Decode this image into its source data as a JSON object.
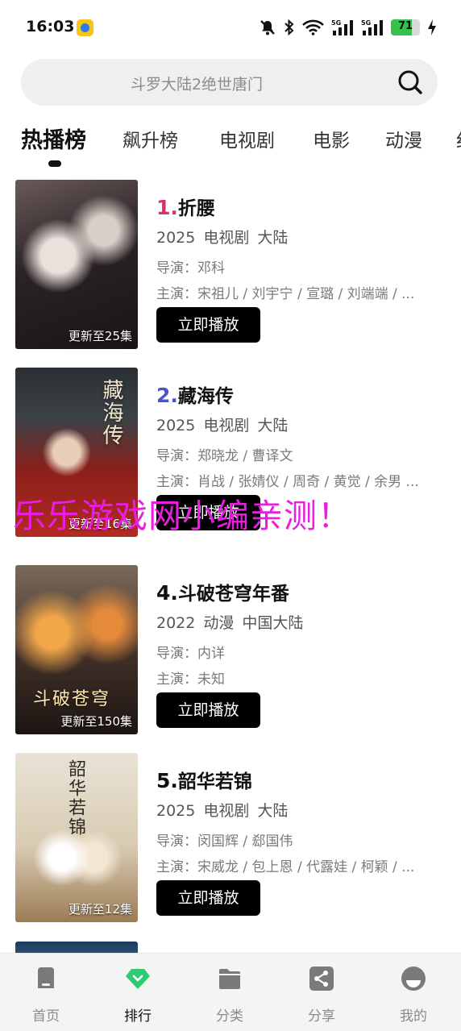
{
  "status_bar": {
    "time": "16:03",
    "battery": "71",
    "battery_level": 0.71,
    "network_labels": [
      "5G",
      "5G"
    ]
  },
  "search": {
    "placeholder": "斗罗大陆2绝世唐门"
  },
  "tabs": [
    "热播榜",
    "飙升榜",
    "电视剧",
    "电影",
    "动漫",
    "纪"
  ],
  "active_tab": 0,
  "items": [
    {
      "rank": "1.",
      "title": "折腰",
      "rank_color": "#d6336c",
      "meta": "2025 电视剧 大陆",
      "director": "导演：邓科",
      "cast": "主演：宋祖儿 / 刘宇宁 / 宣璐 / 刘端端 / ...",
      "poster_caption": "更新至25集",
      "button": "立即播放"
    },
    {
      "rank": "2.",
      "title": "藏海传",
      "rank_color": "#4a55c8",
      "meta": "2025 电视剧 大陆",
      "director": "导演：郑晓龙 / 曹译文",
      "cast": "主演：肖战 / 张婧仪 / 周奇 / 黄觉 / 余男 ...",
      "poster_caption": "更新至16集",
      "poster_title": "藏海传",
      "button": "立即播放"
    },
    {
      "rank": "4.",
      "title": "斗破苍穹年番",
      "rank_color": "#111111",
      "meta": "2022 动漫 中国大陆",
      "director": "导演：内详",
      "cast": "主演：未知",
      "poster_caption": "更新至150集",
      "poster_title": "斗破苍穹",
      "button": "立即播放"
    },
    {
      "rank": "5.",
      "title": "韶华若锦",
      "rank_color": "#111111",
      "meta": "2025 电视剧 大陆",
      "director": "导演：闵国辉 / 郄国伟",
      "cast": "主演：宋威龙 / 包上恩 / 代露娃 / 柯颖 / ...",
      "poster_caption": "更新至12集",
      "poster_title": "韶华若锦",
      "button": "立即播放"
    }
  ],
  "watermark": "乐乐游戏网小编亲测！",
  "bottom_nav": [
    {
      "label": "首页",
      "icon": "home-icon"
    },
    {
      "label": "排行",
      "icon": "ranking-icon"
    },
    {
      "label": "分类",
      "icon": "folder-icon"
    },
    {
      "label": "分享",
      "icon": "share-icon"
    },
    {
      "label": "我的",
      "icon": "profile-icon"
    }
  ],
  "active_nav": 1,
  "colors": {
    "accent_green": "#2ecc71",
    "button_bg": "#000000",
    "watermark": "#e91ee0"
  }
}
